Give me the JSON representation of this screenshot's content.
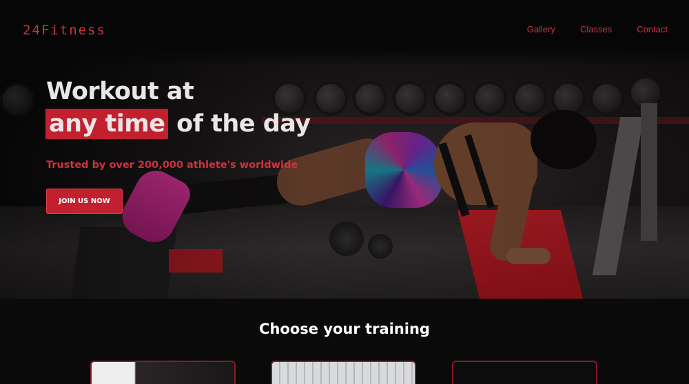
{
  "brand": {
    "logo": "24Fitness"
  },
  "nav": {
    "items": [
      {
        "label": "Gallery"
      },
      {
        "label": "Classes"
      },
      {
        "label": "Contact"
      }
    ]
  },
  "hero": {
    "title_line1": "Workout at",
    "title_highlight": "any time",
    "title_rest": "of the day",
    "subtitle": "Trusted by over 200,000 athlete's worldwide",
    "cta_label": "JOIN US NOW"
  },
  "training": {
    "title": "Choose your training",
    "cards": [
      {
        "name": "training-card-1"
      },
      {
        "name": "training-card-2"
      },
      {
        "name": "training-card-3"
      }
    ]
  },
  "colors": {
    "accent": "#c2202f",
    "accent_text": "#d0323d",
    "background": "#0b0a0b"
  }
}
